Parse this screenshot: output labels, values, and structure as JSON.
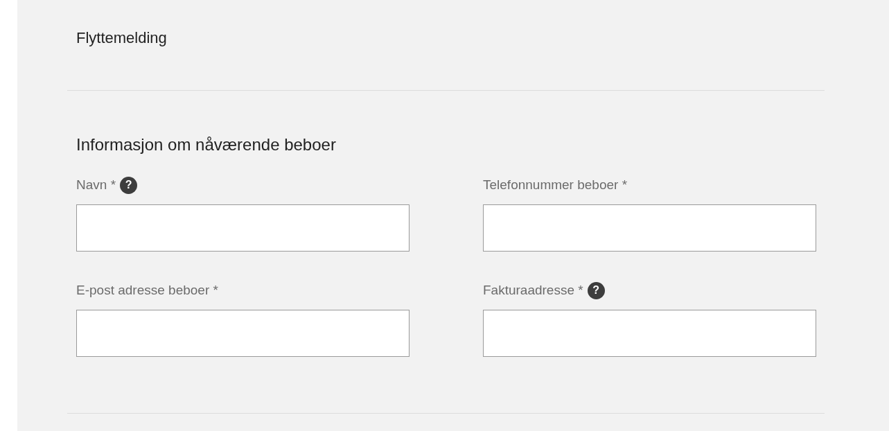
{
  "title": "Flyttemelding",
  "section": {
    "heading": "Informasjon om nåværende beboer",
    "fields": [
      {
        "label": "Navn *",
        "help": "?"
      },
      {
        "label": "Telefonnummer beboer *"
      },
      {
        "label": "E-post adresse beboer *"
      },
      {
        "label": "Fakturaadresse *",
        "help": "?"
      }
    ]
  }
}
